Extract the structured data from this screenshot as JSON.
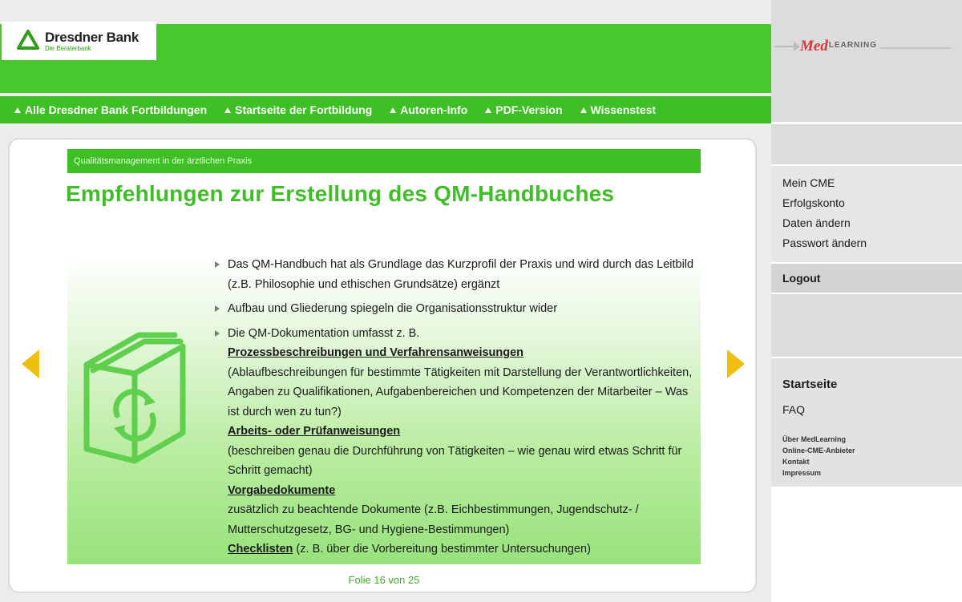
{
  "header": {
    "logo": {
      "name": "Dresdner Bank",
      "tagline": "Die Beraterbank"
    },
    "nav": [
      "Alle Dresdner Bank Fortbildungen",
      "Startseite der Fortbildung",
      "Autoren-Info",
      "PDF-Version",
      "Wissenstest"
    ]
  },
  "sidebar": {
    "partner_logo": {
      "med": "Med",
      "learning": "LEARNING"
    },
    "account_links": [
      "Mein CME",
      "Erfolgskonto",
      "Daten ändern",
      "Passwort ändern"
    ],
    "logout": "Logout",
    "main_links": [
      "Startseite",
      "FAQ"
    ],
    "footer_links": [
      "Über MedLearning",
      "Online-CME-Anbieter",
      "Kontakt",
      "Impressum"
    ]
  },
  "content": {
    "course": "Qualitätsmanagement in der ärztlichen Praxis",
    "title": "Empfehlungen zur Erstellung des QM-Handbuches",
    "bullets": [
      "Das QM-Handbuch hat als Grundlage das Kurzprofil der Praxis und wird durch das Leitbild (z.B. Philosophie und ethischen Grundsätze) ergänzt",
      "Aufbau und Gliederung spiegeln die Organisationsstruktur wider",
      "Die QM-Dokumentation umfasst z. B."
    ],
    "items": [
      {
        "heading": "Prozessbeschreibungen und Verfahrensanweisungen",
        "text": "(Ablaufbeschreibungen für bestimmte Tätigkeiten mit Darstellung der Verantwortlichkeiten, Angaben zu Qualifikationen, Aufgabenbereichen und Kompetenzen der Mitarbeiter – Was ist durch wen zu tun?)"
      },
      {
        "heading": "Arbeits- oder Prüfanweisungen",
        "text": "(beschreiben genau die Durchführung von Tätigkeiten – wie genau wird etwas Schritt für Schritt gemacht)"
      },
      {
        "heading": "Vorgabedokumente",
        "text": "zusätzlich zu beachtende Dokumente (z.B. Eichbestimmungen, Jugendschutz- /  Mutterschutzgesetz, BG- und Hygiene-Bestimmungen)"
      },
      {
        "heading": "Checklisten",
        "text": " (z. B. über die Vorbereitung bestimmter Untersuchungen)"
      }
    ],
    "slide_counter": "Folie 16 von 25"
  },
  "colors": {
    "brand_green": "#47c92e",
    "nav_green": "#3dbf25",
    "arrow_yellow": "#f0c010",
    "medlearning_red": "#d8343a"
  }
}
